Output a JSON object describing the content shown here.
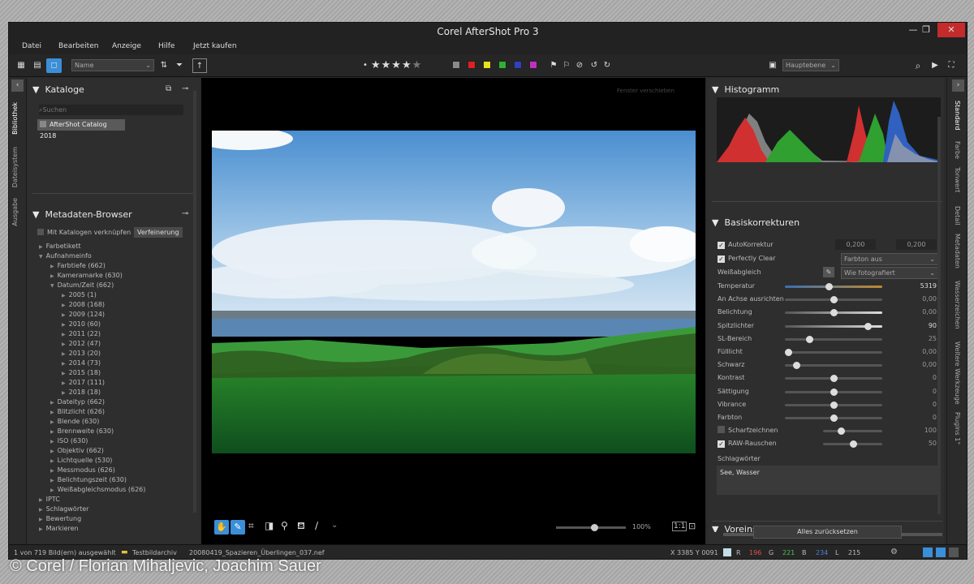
{
  "window": {
    "title": "Corel AfterShot Pro 3"
  },
  "menu": [
    "Datei",
    "Bearbeiten",
    "Anzeige",
    "Hilfe",
    "Jetzt kaufen"
  ],
  "toolbar": {
    "sort_value": "Name",
    "layer_value": "Hauptebene",
    "rating_stars": 5,
    "color_labels": [
      "#8a8a8a",
      "#e02020",
      "#e8e020",
      "#30b030",
      "#3040c0",
      "#c030c0"
    ]
  },
  "left_tabs": [
    "Bibliothek",
    "Dateisystem",
    "Ausgabe"
  ],
  "catalogs": {
    "header": "Kataloge",
    "search_placeholder": "Suchen",
    "items": [
      "AfterShot Catalog 2018"
    ]
  },
  "metadata": {
    "header": "Metadaten-Browser",
    "link_label": "Mit Katalogen verknüpfen",
    "refine_label": "Verfeinerung",
    "tree": [
      {
        "t": "Farbetikett",
        "l": 0,
        "a": "▶"
      },
      {
        "t": "Aufnahmeinfo",
        "l": 0,
        "a": "▼"
      },
      {
        "t": "Farbtiefe (662)",
        "l": 1,
        "a": "▶"
      },
      {
        "t": "Kameramarke (630)",
        "l": 1,
        "a": "▶"
      },
      {
        "t": "Datum/Zeit (662)",
        "l": 1,
        "a": "▼"
      },
      {
        "t": "2005 (1)",
        "l": 2,
        "a": "▶"
      },
      {
        "t": "2008 (168)",
        "l": 2,
        "a": "▶"
      },
      {
        "t": "2009 (124)",
        "l": 2,
        "a": "▶"
      },
      {
        "t": "2010 (60)",
        "l": 2,
        "a": "▶"
      },
      {
        "t": "2011 (22)",
        "l": 2,
        "a": "▶"
      },
      {
        "t": "2012 (47)",
        "l": 2,
        "a": "▶"
      },
      {
        "t": "2013 (20)",
        "l": 2,
        "a": "▶"
      },
      {
        "t": "2014 (73)",
        "l": 2,
        "a": "▶"
      },
      {
        "t": "2015 (18)",
        "l": 2,
        "a": "▶"
      },
      {
        "t": "2017 (111)",
        "l": 2,
        "a": "▶"
      },
      {
        "t": "2018 (18)",
        "l": 2,
        "a": "▶"
      },
      {
        "t": "Dateityp (662)",
        "l": 1,
        "a": "▶"
      },
      {
        "t": "Blitzlicht (626)",
        "l": 1,
        "a": "▶"
      },
      {
        "t": "Blende (630)",
        "l": 1,
        "a": "▶"
      },
      {
        "t": "Brennweite (630)",
        "l": 1,
        "a": "▶"
      },
      {
        "t": "ISO (630)",
        "l": 1,
        "a": "▶"
      },
      {
        "t": "Objektiv (662)",
        "l": 1,
        "a": "▶"
      },
      {
        "t": "Lichtquelle (530)",
        "l": 1,
        "a": "▶"
      },
      {
        "t": "Messmodus (626)",
        "l": 1,
        "a": "▶"
      },
      {
        "t": "Belichtungszeit (630)",
        "l": 1,
        "a": "▶"
      },
      {
        "t": "Weißabgleichsmodus (626)",
        "l": 1,
        "a": "▶"
      },
      {
        "t": "IPTC",
        "l": 0,
        "a": "▶"
      },
      {
        "t": "Schlagwörter",
        "l": 0,
        "a": "▶"
      },
      {
        "t": "Bewertung",
        "l": 0,
        "a": "▶"
      },
      {
        "t": "Markieren",
        "l": 0,
        "a": "▶"
      }
    ]
  },
  "viewer": {
    "zoom": "100%",
    "zoom_level": 0.55,
    "tooltip": "Fenster verschieben"
  },
  "histogram": {
    "header": "Histogramm"
  },
  "basis": {
    "header": "Basiskorrekturen",
    "auto_label": "AutoKorrektur",
    "auto_v1": "0,200",
    "auto_v2": "0,200",
    "perfect_label": "Perfectly Clear",
    "perfect_select": "Farbton aus",
    "wb_label": "Weißabgleich",
    "wb_select": "Wie fotografiert",
    "sliders": [
      {
        "label": "Temperatur",
        "value": "5319",
        "pos": 0.45
      },
      {
        "label": "An Achse ausrichten",
        "value": "0,00",
        "pos": 0.5
      },
      {
        "label": "Belichtung",
        "value": "0,00",
        "pos": 0.5
      },
      {
        "label": "Spitzlichter",
        "value": "90",
        "pos": 0.85
      },
      {
        "label": "SL-Bereich",
        "value": "25",
        "pos": 0.25
      },
      {
        "label": "Fülllicht",
        "value": "0,00",
        "pos": 0.03
      },
      {
        "label": "Schwarz",
        "value": "0,00",
        "pos": 0.12
      },
      {
        "label": "Kontrast",
        "value": "0",
        "pos": 0.5
      },
      {
        "label": "Sättigung",
        "value": "0",
        "pos": 0.5
      },
      {
        "label": "Vibrance",
        "value": "0",
        "pos": 0.5
      },
      {
        "label": "Farbton",
        "value": "0",
        "pos": 0.5
      }
    ],
    "sharpen_label": "Scharfzeichnen",
    "sharpen_value": "100",
    "sharpen_pos": 0.3,
    "raw_label": "RAW-Rauschen",
    "raw_value": "50",
    "raw_pos": 0.5,
    "keywords_label": "Schlagwörter",
    "keywords_value": "See, Wasser"
  },
  "presets": {
    "header": "Voreinstellungen",
    "reset": "Alles zurücksetzen"
  },
  "right_tabs": [
    "Standard",
    "Farbe",
    "Tonwert",
    "Detail",
    "Metadaten",
    "Wasserzeichen",
    "Weitere Werkzeuge",
    "Plugins 1°"
  ],
  "status": {
    "selection": "1 von 719 Bild(ern) ausgewählt",
    "folder": "Testbildarchiv",
    "file": "20080419_Spazieren_Überlingen_037.nef",
    "coords": "X 3385  Y 0091",
    "r_label": "R",
    "r": "196",
    "g_label": "G",
    "g": "221",
    "b_label": "B",
    "b": "234",
    "l_label": "L",
    "l": "215"
  },
  "credit": "© Corel / Florian Mihaljevic, Joachim Sauer"
}
